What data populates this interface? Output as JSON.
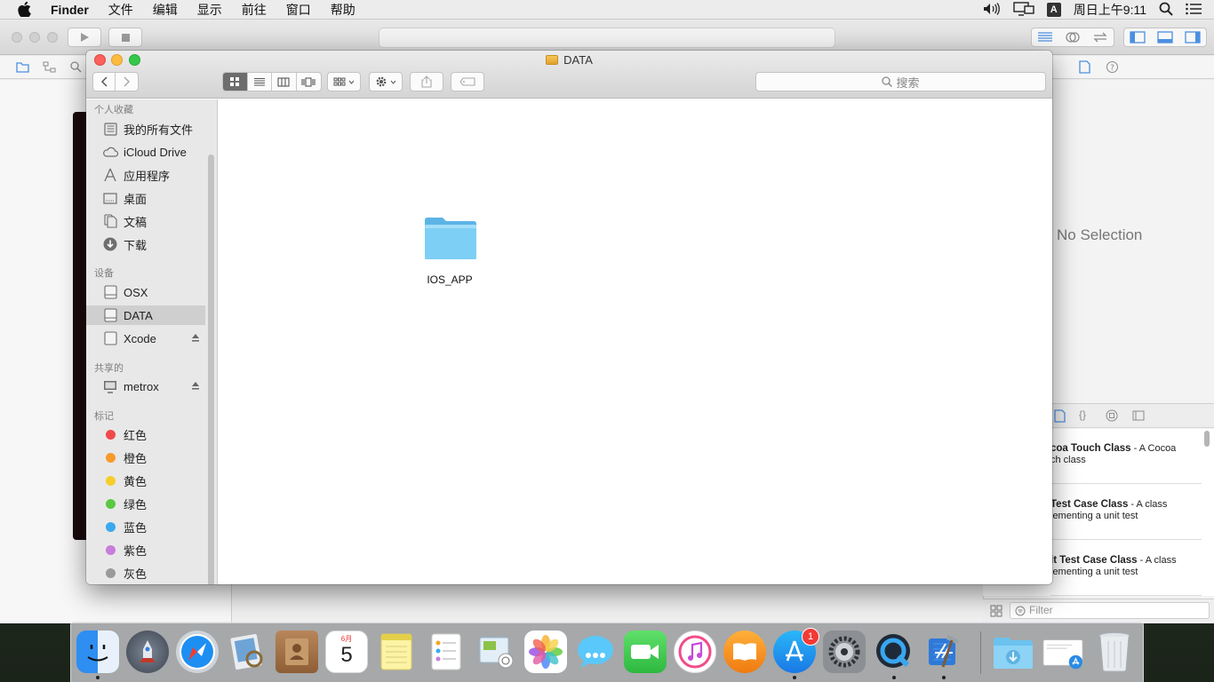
{
  "menubar": {
    "app_name": "Finder",
    "menus": [
      "文件",
      "编辑",
      "显示",
      "前往",
      "窗口",
      "帮助"
    ],
    "input_method": "A",
    "clock": "周日上午9:11"
  },
  "xcode": {
    "no_selection": "No Selection",
    "library_items": [
      {
        "name": "coa Touch Class",
        "desc_inline": " - A Cocoa",
        "desc_line2": "ch class"
      },
      {
        "name": "Test Case Class",
        "desc_inline": " - A class",
        "desc_line2": "lementing a unit test"
      },
      {
        "name": "it Test Case Class",
        "desc_inline": " - A class",
        "desc_line2": "lementing a unit test"
      }
    ],
    "filter_placeholder": "Filter"
  },
  "finder": {
    "title": "DATA",
    "search_placeholder": "搜索",
    "sidebar": {
      "favorites_header": "个人收藏",
      "favorites": [
        {
          "label": "我的所有文件",
          "icon": "all-files-icon"
        },
        {
          "label": "iCloud Drive",
          "icon": "cloud-icon"
        },
        {
          "label": "应用程序",
          "icon": "applications-icon"
        },
        {
          "label": "桌面",
          "icon": "desktop-icon"
        },
        {
          "label": "文稿",
          "icon": "documents-icon"
        },
        {
          "label": "下载",
          "icon": "downloads-icon"
        }
      ],
      "devices_header": "设备",
      "devices": [
        {
          "label": "OSX",
          "icon": "disk-icon",
          "eject": false
        },
        {
          "label": "DATA",
          "icon": "disk-icon",
          "eject": false,
          "selected": true
        },
        {
          "label": "Xcode",
          "icon": "disk-icon",
          "eject": true
        }
      ],
      "shared_header": "共享的",
      "shared": [
        {
          "label": "metrox",
          "icon": "computer-icon",
          "eject": true
        }
      ],
      "tags_header": "标记",
      "tags": [
        {
          "label": "红色",
          "color": "#f0494a"
        },
        {
          "label": "橙色",
          "color": "#f89a2b"
        },
        {
          "label": "黄色",
          "color": "#f7cd2c"
        },
        {
          "label": "绿色",
          "color": "#5bc83f"
        },
        {
          "label": "蓝色",
          "color": "#3aa8ef"
        },
        {
          "label": "紫色",
          "color": "#c77ddc"
        },
        {
          "label": "灰色",
          "color": "#9a9a9a"
        }
      ]
    },
    "items": [
      {
        "name": "IOS_APP",
        "type": "folder"
      }
    ]
  },
  "dock": {
    "app_store_badge": "1",
    "calendar_month": "6月",
    "calendar_day": "5",
    "apps": [
      "Finder",
      "Launchpad",
      "Safari",
      "Preview",
      "Contacts",
      "Calendar",
      "Notes",
      "Reminders",
      "Photo Booth",
      "Photos",
      "Messages",
      "FaceTime",
      "iTunes",
      "iBooks",
      "App Store",
      "System Preferences",
      "QuickTime Player",
      "Xcode",
      "Downloads",
      "Documents",
      "Trash"
    ]
  }
}
